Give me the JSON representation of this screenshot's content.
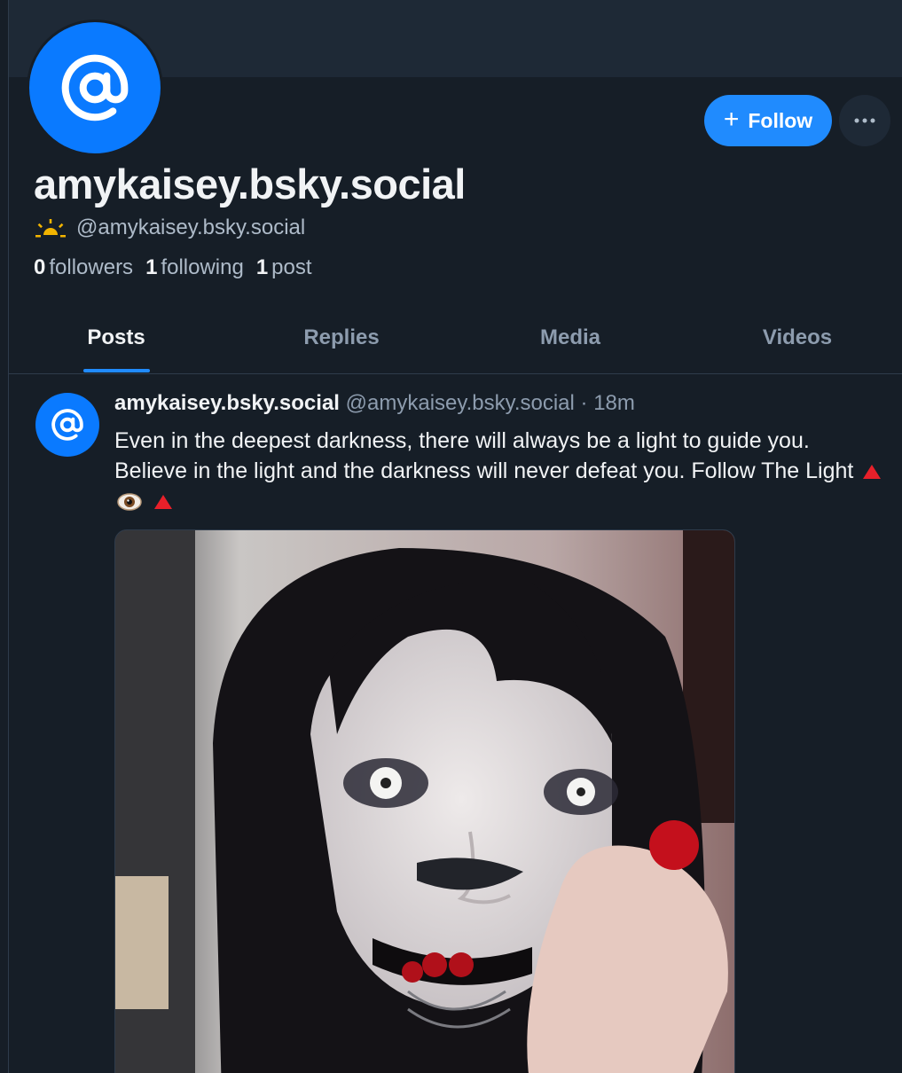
{
  "profile": {
    "display_name": "amykaisey.bsky.social",
    "handle": "@amykaisey.bsky.social",
    "followers_count": "0",
    "followers_label": "followers",
    "following_count": "1",
    "following_label": "following",
    "posts_count": "1",
    "posts_label": "post",
    "avatar_icon": "at-sign-icon",
    "handle_icon": "sunrise-icon"
  },
  "actions": {
    "follow_label": "Follow",
    "more_icon": "ellipsis-icon"
  },
  "tabs": [
    {
      "label": "Posts",
      "active": true
    },
    {
      "label": "Replies",
      "active": false
    },
    {
      "label": "Media",
      "active": false
    },
    {
      "label": "Videos",
      "active": false
    }
  ],
  "post": {
    "author": "amykaisey.bsky.social",
    "handle": "@amykaisey.bsky.social",
    "separator": "·",
    "time": "18m",
    "text": "Even in the deepest darkness, there will always be a light to guide you. Believe in the light and the darkness will never defeat you. Follow The Light",
    "trailing_emoji": [
      "red-triangle-icon",
      "eye-icon",
      "red-triangle-icon"
    ],
    "image_subject": "portrait-photo"
  },
  "colors": {
    "background": "#161e27",
    "banner": "#1e2936",
    "accent": "#208bfe",
    "avatar": "#0a7aff",
    "muted_text": "#8d9cae"
  }
}
